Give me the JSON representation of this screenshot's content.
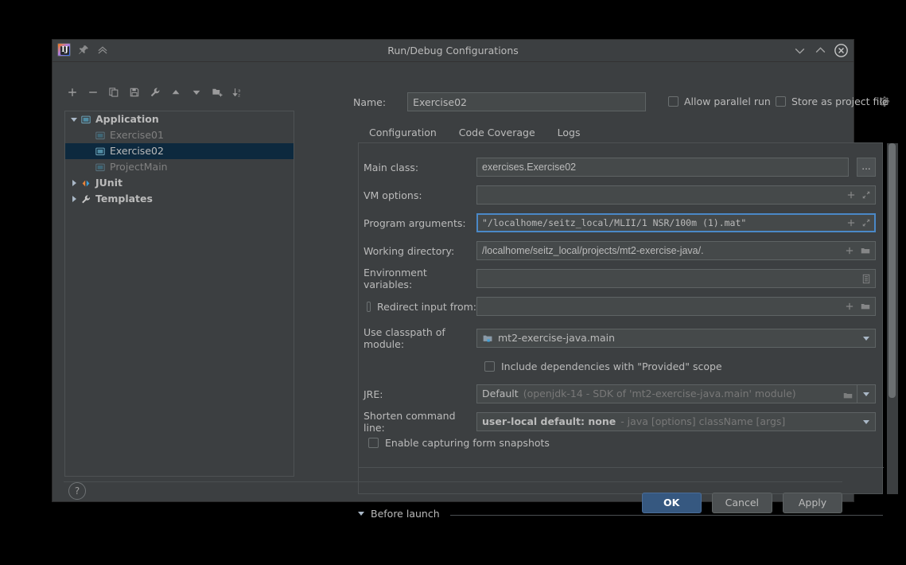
{
  "window": {
    "title": "Run/Debug Configurations",
    "logo_glyph": "IJ",
    "pin_icon": "pin-icon",
    "collapse_icon": "chevron-double-up-icon",
    "minimize_icon": "chevron-down-icon",
    "maximize_icon": "chevron-up-icon",
    "close_icon": "close-icon"
  },
  "toolbar": {
    "items": [
      {
        "name": "add-configuration-button",
        "icon": "plus-icon"
      },
      {
        "name": "remove-configuration-button",
        "icon": "minus-icon"
      },
      {
        "name": "copy-configuration-button",
        "icon": "copy-icon"
      },
      {
        "name": "save-configuration-button",
        "icon": "save-icon"
      },
      {
        "name": "edit-templates-button",
        "icon": "wrench-icon"
      },
      {
        "name": "move-up-button",
        "icon": "arrow-up-icon"
      },
      {
        "name": "move-down-button",
        "icon": "arrow-down-icon"
      },
      {
        "name": "move-into-folder-button",
        "icon": "folder-add-icon"
      },
      {
        "name": "sort-configurations-button",
        "icon": "sort-az-icon"
      }
    ]
  },
  "tree": {
    "nodes": [
      {
        "label": "Application",
        "level": 0,
        "expanded": true,
        "icon": "application-icon",
        "style": "bold",
        "selected": false
      },
      {
        "label": "Exercise01",
        "level": 1,
        "expanded": null,
        "icon": "application-icon",
        "style": "dim",
        "selected": false
      },
      {
        "label": "Exercise02",
        "level": 1,
        "expanded": null,
        "icon": "application-icon",
        "style": "sel",
        "selected": true
      },
      {
        "label": "ProjectMain",
        "level": 1,
        "expanded": null,
        "icon": "application-icon",
        "style": "dim",
        "selected": false
      },
      {
        "label": "JUnit",
        "level": 0,
        "expanded": false,
        "icon": "junit-icon",
        "style": "bold",
        "selected": false
      },
      {
        "label": "Templates",
        "level": 0,
        "expanded": false,
        "icon": "wrench-icon",
        "style": "bold",
        "selected": false
      }
    ]
  },
  "help_button": {
    "label": "?"
  },
  "header": {
    "name_label": "Name:",
    "name_value": "Exercise02",
    "allow_parallel_run": {
      "label": "Allow parallel run",
      "checked": false
    },
    "store_as_project_file": {
      "label": "Store as project file",
      "checked": false
    },
    "store_gear_icon": "gear-icon"
  },
  "tabs": [
    {
      "label": "Configuration",
      "active": true
    },
    {
      "label": "Code Coverage",
      "active": false
    },
    {
      "label": "Logs",
      "active": false
    }
  ],
  "form": {
    "main_class": {
      "label": "Main class:",
      "value": "exercises.Exercise02",
      "browse_label": "..."
    },
    "vm_options": {
      "label": "VM options:",
      "value": "",
      "icons": [
        "plus-icon",
        "expand-icon"
      ]
    },
    "program_arguments": {
      "label": "Program arguments:",
      "value": "\"/localhome/seitz_local/MLII/1 NSR/100m (1).mat\"",
      "value_prefix": "\"",
      "value_rest": "/localhome/seitz_local/MLII/1 NSR/100m (1).mat\"",
      "focused": true,
      "icons": [
        "plus-icon",
        "expand-icon"
      ]
    },
    "working_directory": {
      "label": "Working directory:",
      "value": "/localhome/seitz_local/projects/mt2-exercise-java/.",
      "icons": [
        "plus-icon",
        "folder-icon"
      ]
    },
    "environment_variables": {
      "label": "Environment variables:",
      "value": "",
      "icons": [
        "list-edit-icon"
      ]
    },
    "redirect_input": {
      "label": "Redirect input from:",
      "checked": false,
      "value": "",
      "icons": [
        "plus-icon",
        "folder-icon"
      ]
    },
    "classpath_module": {
      "label": "Use classpath of module:",
      "value": "mt2-exercise-java.main",
      "icon": "module-icon"
    },
    "include_provided": {
      "label": "Include dependencies with \"Provided\" scope",
      "checked": false
    },
    "jre": {
      "label": "JRE:",
      "value": "Default",
      "hint": "(openjdk-14 - SDK of 'mt2-exercise-java.main' module)",
      "icons": [
        "folder-icon"
      ]
    },
    "shorten_command_line": {
      "label": "Shorten command line:",
      "value": "user-local default: none",
      "hint": "- java [options] className [args]"
    },
    "enable_form_snapshots": {
      "label": "Enable capturing form snapshots",
      "checked": false
    }
  },
  "before_launch": {
    "label": "Before launch",
    "expanded": true
  },
  "footer": {
    "ok": "OK",
    "cancel": "Cancel",
    "apply": "Apply"
  },
  "colors": {
    "accent": "#4a88c7",
    "primary_button": "#365880",
    "selection": "#0d293e",
    "panel": "#3c3f41",
    "field": "#45494a"
  }
}
